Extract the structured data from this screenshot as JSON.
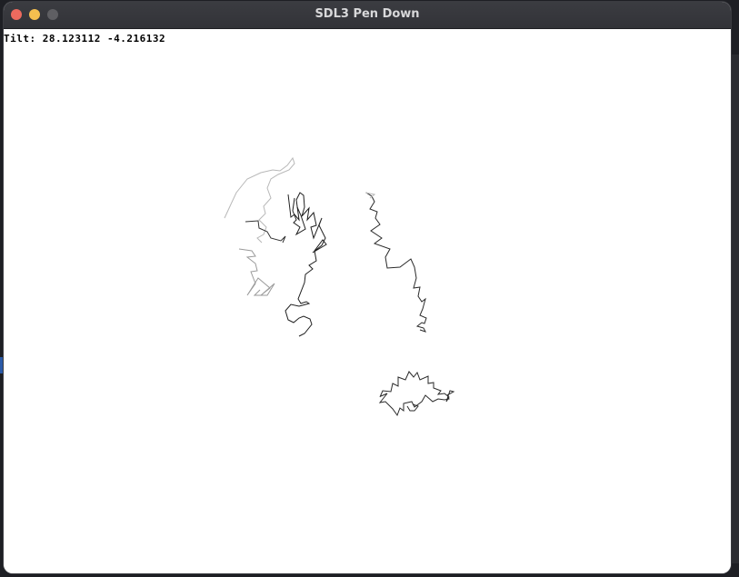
{
  "window": {
    "title": "SDL3 Pen Down",
    "controls": [
      "close",
      "minimize",
      "zoom"
    ]
  },
  "status": {
    "label": "Tilt:",
    "tilt_x": "28.123112",
    "tilt_y": "-4.216132",
    "text": "Tilt: 28.123112 -4.216132"
  },
  "colors": {
    "stroke_dark": "#222222",
    "stroke_light": "#b8b8b8",
    "titlebar": "#38393e"
  }
}
